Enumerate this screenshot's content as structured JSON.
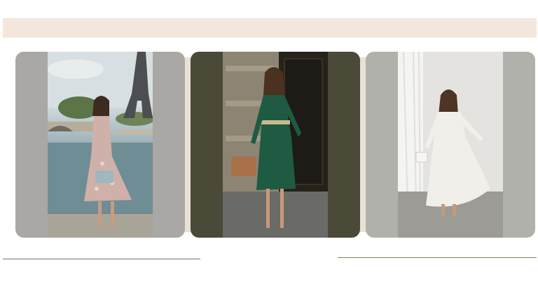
{
  "gallery": {
    "cards": [
      {
        "alt": "",
        "tone": "#a9a8a4"
      },
      {
        "alt": "",
        "tone": "#4b4938"
      },
      {
        "alt": "",
        "tone": "#b1b1ac"
      }
    ]
  },
  "colors": {
    "banner": "#f3e7dd",
    "rule_left": "#6f6f6f",
    "rule_right": "#8a7b5a"
  }
}
